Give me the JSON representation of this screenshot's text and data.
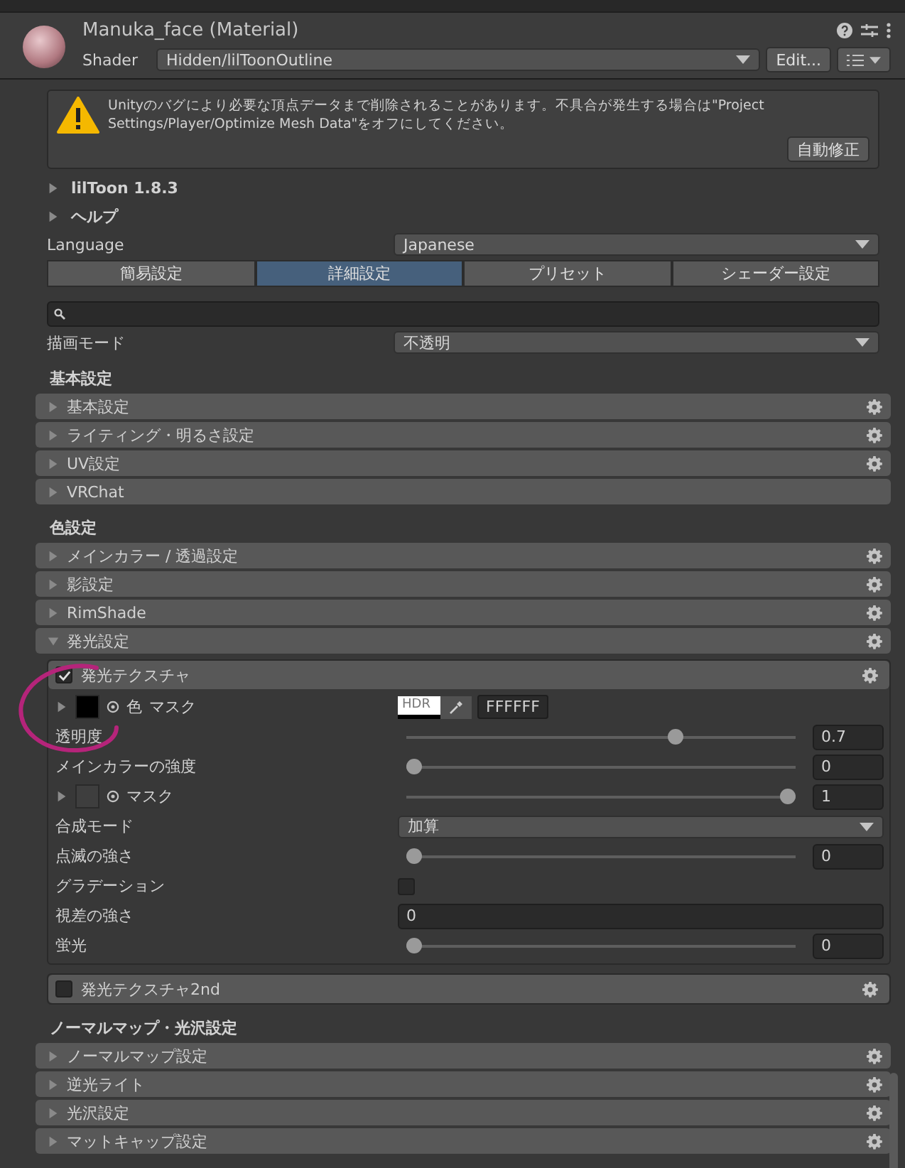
{
  "header": {
    "title": "Manuka_face (Material)",
    "shader_label": "Shader",
    "shader_value": "Hidden/lilToonOutline",
    "edit_button": "Edit..."
  },
  "warning": {
    "text": "Unityのバグにより必要な頂点データまで削除されることがあります。不具合が発生する場合は\"Project Settings/Player/Optimize Mesh Data\"をオフにしてください。",
    "button": "自動修正"
  },
  "foldouts": [
    {
      "label": "lilToon 1.8.3",
      "expanded": false
    },
    {
      "label": "ヘルプ",
      "expanded": false
    }
  ],
  "language": {
    "label": "Language",
    "value": "Japanese"
  },
  "tabs": [
    {
      "label": "簡易設定",
      "selected": false
    },
    {
      "label": "詳細設定",
      "selected": true
    },
    {
      "label": "プリセット",
      "selected": false
    },
    {
      "label": "シェーダー設定",
      "selected": false
    }
  ],
  "render_mode": {
    "label": "描画モード",
    "value": "不透明"
  },
  "sections": [
    {
      "title": "基本設定",
      "items": [
        {
          "label": "基本設定",
          "expanded": false,
          "gear": true
        },
        {
          "label": "ライティング・明るさ設定",
          "expanded": false,
          "gear": true
        },
        {
          "label": "UV設定",
          "expanded": false,
          "gear": true
        },
        {
          "label": "VRChat",
          "expanded": false,
          "gear": false
        }
      ]
    },
    {
      "title": "色設定",
      "items": [
        {
          "label": "メインカラー / 透過設定",
          "expanded": false,
          "gear": true
        },
        {
          "label": "影設定",
          "expanded": false,
          "gear": true
        },
        {
          "label": "RimShade",
          "expanded": false,
          "gear": true
        },
        {
          "label": "発光設定",
          "expanded": true,
          "gear": true,
          "groups": [
            {
              "label": "発光テクスチャ",
              "checked": true,
              "rows": [
                {
                  "kind": "texture",
                  "expanded": false,
                  "label": "色",
                  "label_2": "マスク",
                  "hdr": "HDR",
                  "hex": "FFFFFF"
                },
                {
                  "kind": "slider",
                  "label": "透明度",
                  "level": 0.7,
                  "value": "0.7"
                },
                {
                  "kind": "slider",
                  "label": "メインカラーの強度",
                  "level": 0,
                  "value": "0"
                },
                {
                  "kind": "texture_slider",
                  "expanded": false,
                  "label": "マスク",
                  "level": 1,
                  "value": "1"
                },
                {
                  "kind": "dropdown",
                  "label": "合成モード",
                  "value": "加算"
                },
                {
                  "kind": "slider",
                  "label": "点滅の強さ",
                  "level": 0,
                  "value": "0"
                },
                {
                  "kind": "toggle",
                  "label": "グラデーション",
                  "checked": false
                },
                {
                  "kind": "number",
                  "label": "視差の強さ",
                  "value": "0"
                },
                {
                  "kind": "slider",
                  "label": "蛍光",
                  "level": 0,
                  "value": "0"
                }
              ]
            },
            {
              "label": "発光テクスチャ2nd",
              "checked": false
            }
          ]
        }
      ]
    },
    {
      "title": "ノーマルマップ・光沢設定",
      "items": [
        {
          "label": "ノーマルマップ設定",
          "expanded": false,
          "gear": true
        },
        {
          "label": "逆光ライト",
          "expanded": false,
          "gear": true
        },
        {
          "label": "光沢設定",
          "expanded": false,
          "gear": true
        },
        {
          "label": "マットキャップ設定",
          "expanded": false,
          "gear": true
        }
      ]
    }
  ]
}
